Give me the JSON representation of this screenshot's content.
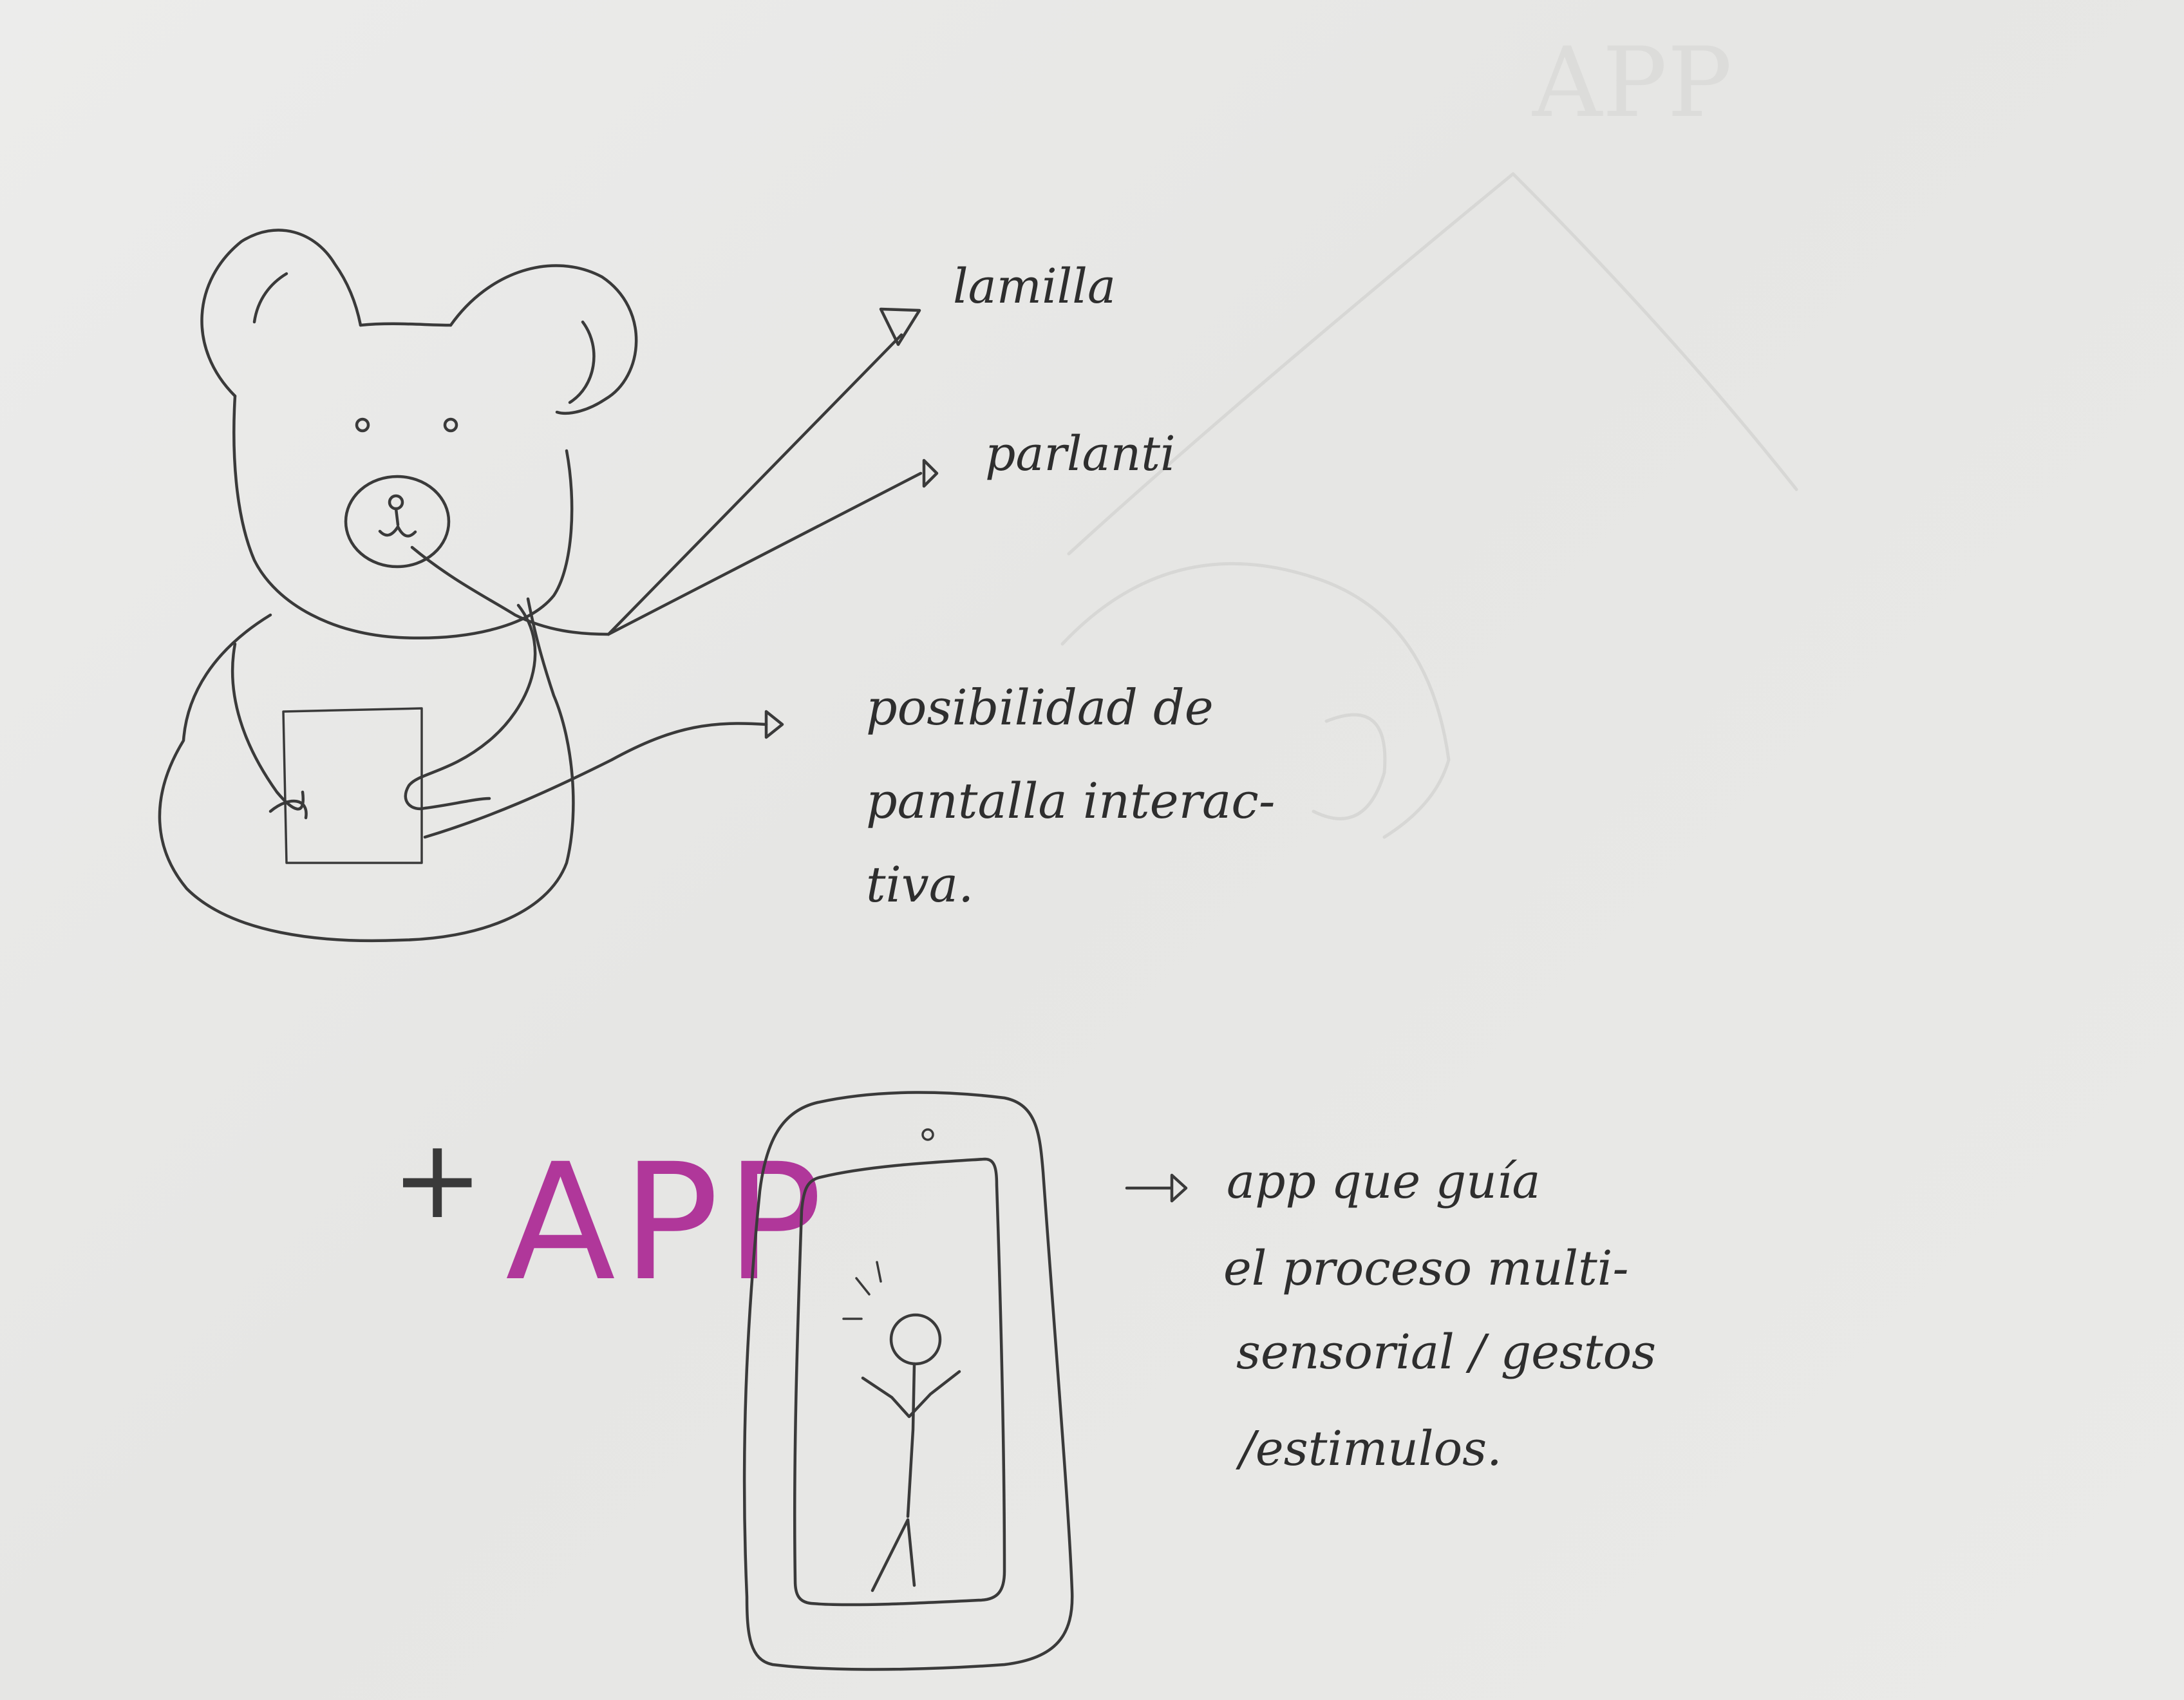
{
  "labels": {
    "bear_part_1": "lamilla",
    "bear_part_2": "parlanti",
    "screen_note_line1": "posibilidad de",
    "screen_note_line2": "pantalla interac-",
    "screen_note_line3": "tiva.",
    "plus_sign": "+",
    "app_word": "APP",
    "app_note_line1": "app que guía",
    "app_note_line2": "el proceso multi-",
    "app_note_line3": "sensorial / gestos",
    "app_note_line4": "/estimulos."
  },
  "ghost": {
    "show_through_text": "APP"
  },
  "colors": {
    "ink": "#3a3a3a",
    "app_accent": "#b0379a",
    "paper": "#e8e8e6"
  }
}
